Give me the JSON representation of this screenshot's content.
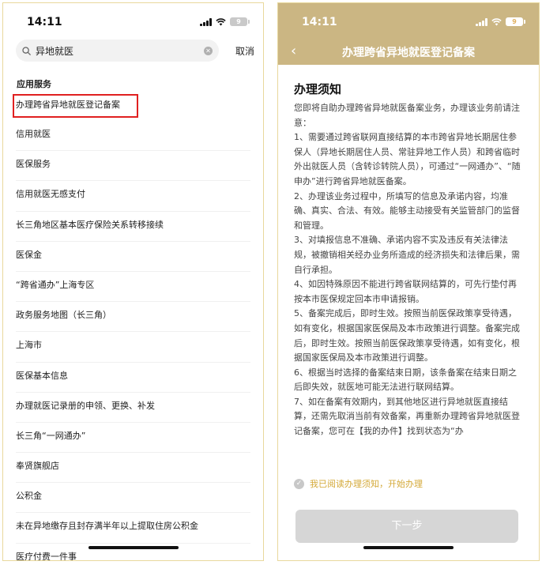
{
  "left": {
    "status": {
      "time": "14:11",
      "battery": "9"
    },
    "search": {
      "query": "异地就医",
      "cancel": "取消"
    },
    "section_title": "应用服务",
    "results": [
      "办理跨省异地就医登记备案",
      "信用就医",
      "医保服务",
      "信用就医无感支付",
      "长三角地区基本医疗保险关系转移接续",
      "医保金",
      "“跨省通办”上海专区",
      "政务服务地图（长三角）",
      "上海市",
      "医保基本信息",
      "办理就医记录册的申领、更换、补发",
      "长三角“一网通办”",
      "奉贤旗舰店",
      "公积金",
      "未在异地缴存且封存满半年以上提取住房公积金",
      "医疗付费一件事"
    ]
  },
  "right": {
    "status": {
      "time": "14:11",
      "battery": "9"
    },
    "nav_title": "办理跨省异地就医登记备案",
    "heading": "办理须知",
    "paragraphs": [
      "您即将自助办理跨省异地就医备案业务，办理该业务前请注意：",
      "1、需要通过跨省联网直接结算的本市跨省异地长期居住参保人（异地长期居住人员、常驻异地工作人员）和跨省临时外出就医人员（含转诊转院人员），可通过“一网通办”、“随申办”进行跨省异地就医备案。",
      "2、办理该业务过程中，所填写的信息及承诺内容，均准确、真实、合法、有效。能够主动接受有关监管部门的监督和管理。",
      "3、对填报信息不准确、承诺内容不实及违反有关法律法规，被撤销相关经办业务所造成的经济损失和法律后果，需自行承担。",
      "4、如因特殊原因不能进行跨省联网结算的，可先行垫付再按本市医保规定回本市申请报销。",
      "5、备案完成后，即时生效。按照当前医保政策享受待遇，如有变化，根据国家医保局及本市政策进行调整。备案完成后，即时生效。按照当前医保政策享受待遇，如有变化，根据国家医保局及本市政策进行调整。",
      "6、根据当时选择的备案结束日期，该条备案在结束日期之后即失效，就医地可能无法进行联网结算。",
      "7、如在备案有效期内，到其他地区进行异地就医直接结算，还需先取消当前有效备案，再重新办理跨省异地就医登记备案，您可在【我的办件】找到状态为“办"
    ],
    "agree_text": "我已阅读办理须知，开始办理",
    "next_button": "下一步"
  }
}
